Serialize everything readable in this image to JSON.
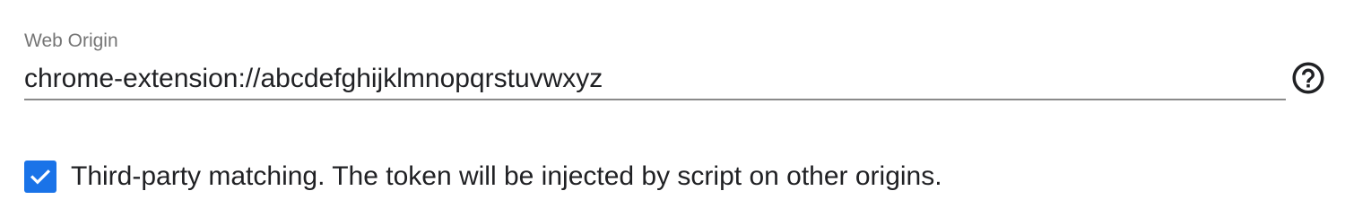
{
  "web_origin": {
    "label": "Web Origin",
    "value": "chrome-extension://abcdefghijklmnopqrstuvwxyz",
    "help_icon": "help-circle-icon"
  },
  "third_party": {
    "checked": true,
    "label": "Third-party matching. The token will be injected by script on other origins.",
    "check_icon": "checkmark-icon"
  },
  "colors": {
    "accent": "#1a73e8",
    "text": "#202124",
    "label": "#757575",
    "underline": "#8a8a8a"
  }
}
